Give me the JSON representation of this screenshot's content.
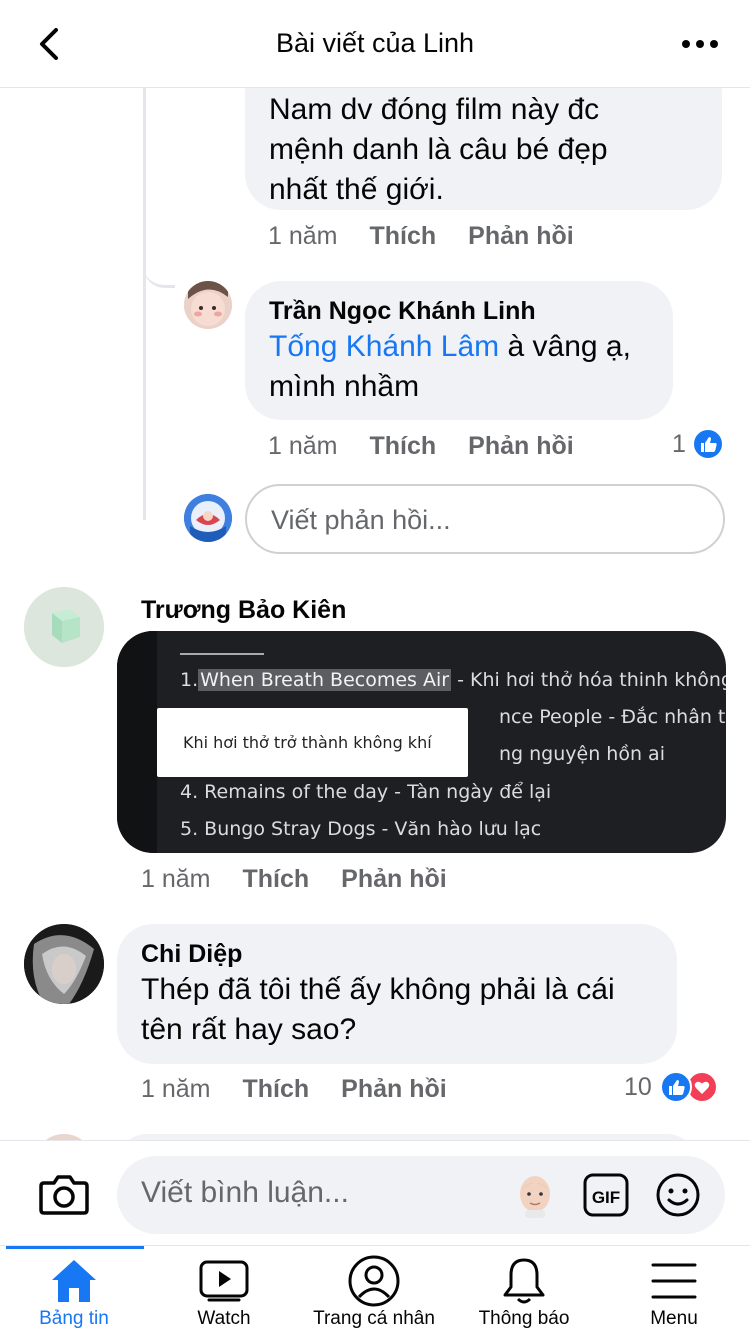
{
  "header": {
    "title": "Bài viết của Linh"
  },
  "comments": [
    {
      "text_lines": [
        "Nam dv đóng film này đc",
        "mệnh danh là câu bé đẹp",
        "nhất thế giới."
      ],
      "time": "1 năm",
      "like_label": "Thích",
      "reply_label": "Phản hồi"
    },
    {
      "author": "Trần Ngọc Khánh Linh",
      "mention": "Tống Khánh Lâm",
      "text_after_mention": " à vâng ạ,",
      "text_line2": "mình nhầm",
      "time": "1 năm",
      "like_label": "Thích",
      "reply_label": "Phản hồi",
      "reaction_count": "1"
    },
    {
      "author": "Trương Bảo Kiên",
      "image": {
        "line1_highlight": "When Breath Becomes Air",
        "line1_prefix": "1.",
        "line1_rest": " - Khi hơi thở hóa thinh không",
        "line2_partial": "nce People - Đắc nhân tâm",
        "line3_partial": "ng nguyện hồn ai",
        "line4": "4. Remains of the day - Tàn ngày để lại",
        "line5": "5. Bungo Stray Dogs - Văn hào lưu lạc",
        "tooltip": "Khi hơi thở trở thành không khí"
      },
      "time": "1 năm",
      "like_label": "Thích",
      "reply_label": "Phản hồi"
    },
    {
      "author": "Chi Diệp",
      "text_lines": [
        "Thép đã tôi thế ấy không phải là cái",
        "tên rất hay sao?"
      ],
      "time": "1 năm",
      "like_label": "Thích",
      "reply_label": "Phản hồi",
      "reaction_count": "10"
    }
  ],
  "reply_input": {
    "placeholder": "Viết phản hồi..."
  },
  "composer": {
    "placeholder": "Viết bình luận...",
    "gif_label": "GIF"
  },
  "nav": {
    "items": [
      {
        "label": "Bảng tin",
        "icon": "home-icon",
        "active": true
      },
      {
        "label": "Watch",
        "icon": "watch-icon"
      },
      {
        "label": "Trang cá nhân",
        "icon": "profile-icon"
      },
      {
        "label": "Thông báo",
        "icon": "bell-icon"
      },
      {
        "label": "Menu",
        "icon": "menu-icon"
      }
    ]
  },
  "colors": {
    "accent": "#1877f2",
    "love": "#f33e58",
    "bubble": "#f0f2f5",
    "secondary_text": "#65676b"
  }
}
